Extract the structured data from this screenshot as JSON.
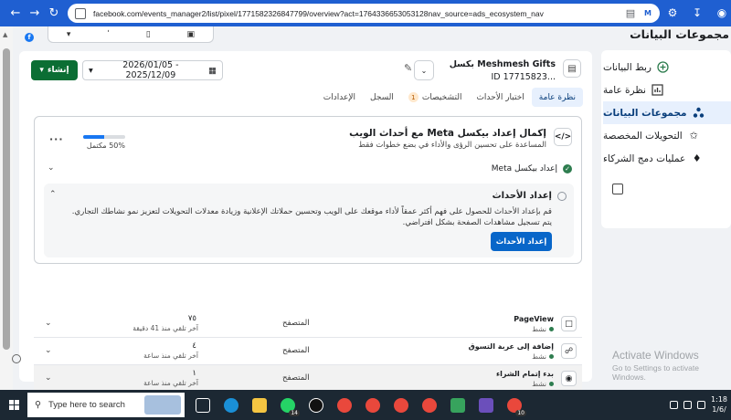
{
  "browser": {
    "url": "facebook.com/events_manager2/list/pixel/1771582326847799/overview?act=1764336653053128nav_source=ads_ecosystem_nav",
    "back_icon": "arrow-left-icon",
    "forward_icon": "arrow-right-icon",
    "reload_icon": "reload-icon"
  },
  "mini_toolbar": {
    "items": [
      "▾",
      "ʹ",
      "▯",
      "▣"
    ]
  },
  "sidebar": {
    "title": "مجموعات البيانات",
    "items": [
      {
        "label": "ربط البيانات",
        "icon": "plus-circle-icon"
      },
      {
        "label": "نظرة عامة",
        "icon": "chart-icon"
      },
      {
        "label": "مجموعات البيانات",
        "icon": "nodes-icon",
        "active": true
      },
      {
        "label": "التحويلات المخصصة",
        "icon": "star-icon"
      },
      {
        "label": "عمليات دمج الشركاء",
        "icon": "handshake-icon"
      }
    ]
  },
  "header": {
    "pixel_name": "Meshmesh Gifts بكسل",
    "pixel_id": "ID 17715823...",
    "create_label": "إنشاء",
    "date_range": "2026/01/05 - 2025/12/09"
  },
  "tabs": [
    {
      "label": "نظرة عامة",
      "active": true
    },
    {
      "label": "اختبار الأحداث"
    },
    {
      "label": "التشخيصات",
      "badge": "1"
    },
    {
      "label": "السجل"
    },
    {
      "label": "الإعدادات"
    }
  ],
  "setup": {
    "title": "إكمال إعداد بيكسل Meta مع أحداث الويب",
    "subtitle": "المساعدة على تحسين الرؤى والأداء في بضع خطوات فقط",
    "progress_percent": 50,
    "progress_label": "50% مكتمل",
    "step1_label": "إعداد بيكسل Meta",
    "step2_title": "إعداد الأحداث",
    "step2_body": "قم بإعداد الأحداث للحصول على فهم أكثر عمقاً لأداء موقعك على الويب وتحسين حملاتك الإعلانية وزيادة معدلات التحويلات لتعزيز نمو نشاطك التجاري. يتم تسجيل مشاهدات الصفحة بشكل افتراضي.",
    "step2_button": "إعداد الأحداث"
  },
  "events": [
    {
      "name": "PageView",
      "status": "نشط",
      "source": "المتصفح",
      "count": "٧٥",
      "last": "آخر تلقي منذ 41 دقيقة",
      "icon": "page-icon"
    },
    {
      "name": "إضافة إلى عربة التسوق",
      "status": "نشط",
      "source": "المتصفح",
      "count": "٤",
      "last": "آخر تلقي منذ ساعة",
      "icon": "cart-icon"
    },
    {
      "name": "بدء إتمام الشراء",
      "status": "نشط",
      "source": "المتصفح",
      "count": "١",
      "last": "آخر تلقي منذ ساعة",
      "icon": "basket-icon",
      "highlight": true
    }
  ],
  "watermark": {
    "line1": "Activate Windows",
    "line2": "Go to Settings to activate Windows."
  },
  "taskbar": {
    "search_placeholder": "Type here to search",
    "badge_14": "14",
    "badge_10": "10",
    "time": "1:18",
    "date": "1/6/"
  }
}
